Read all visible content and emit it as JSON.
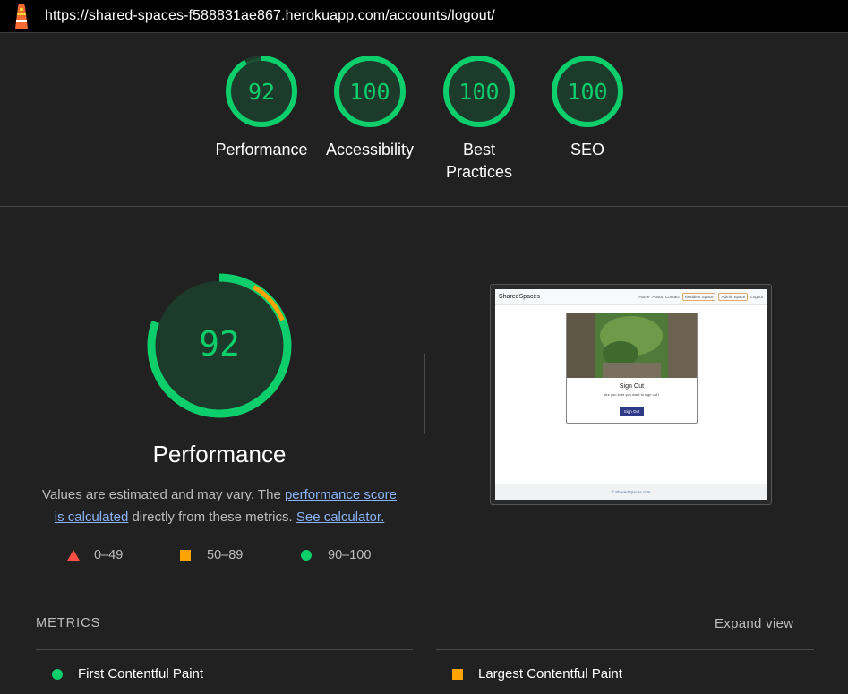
{
  "topbar": {
    "url": "https://shared-spaces-f588831ae867.herokuapp.com/accounts/logout/"
  },
  "gauges": [
    {
      "score": "92",
      "label": "Performance"
    },
    {
      "score": "100",
      "label": "Accessibility"
    },
    {
      "score": "100",
      "label": "Best Practices"
    },
    {
      "score": "100",
      "label": "SEO"
    }
  ],
  "performance": {
    "score": "92",
    "title": "Performance",
    "desc_prefix": "Values are estimated and may vary. The ",
    "desc_link1": "performance score is calculated",
    "desc_middle": " directly from these metrics. ",
    "desc_link2": "See calculator."
  },
  "legend": {
    "fail": "0–49",
    "average": "50–89",
    "pass": "90–100"
  },
  "thumbnail": {
    "brand": "SharedSpaces",
    "nav_links": [
      "Home",
      "About",
      "Contact"
    ],
    "nav_pills": [
      "Resident Space",
      "Admin Space"
    ],
    "nav_last": "Logout",
    "card_title": "Sign Out",
    "card_text": "Are you sure you want to sign out?",
    "card_button": "Sign Out",
    "footer": "© SharedSpaces.com"
  },
  "metrics": {
    "heading": "METRICS",
    "expand": "Expand view",
    "items": [
      {
        "name": "First Contentful Paint",
        "status": "pass"
      },
      {
        "name": "Largest Contentful Paint",
        "status": "average"
      }
    ]
  },
  "colors": {
    "pass": "#0cce6b",
    "average": "#ffa400",
    "fail": "#ff4e42",
    "background": "#212121",
    "link": "#8ab4f8"
  }
}
